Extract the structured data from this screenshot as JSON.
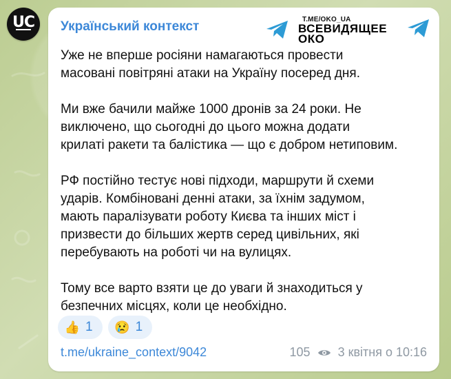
{
  "avatar": {
    "text": "UC"
  },
  "header": {
    "channel_name": "Український контекст"
  },
  "watermark": {
    "small_text": "T.ME/OKO_UA",
    "main_text": "ВСЕВИДЯЩЕЕ\nОКО"
  },
  "message": {
    "paragraphs": [
      "Уже не вперше росіяни намагаються провести\nмасовані повітряні атаки на Україну посеред дня.",
      "Ми вже бачили майже 1000 дронів за 24 роки. Не\nвиключено, що сьогодні до цього можна додати\nкрилаті ракети та балістика — що є добром нетиповим.",
      "РФ постійно тестує нові підходи, маршрути й схеми\nударів. Комбіновані денні атаки, за їхнім задумом,\nмають паралізувати роботу Києва та інших міст і\nпризвести до більших жертв серед цивільних, які\nперебувають на роботі чи на вулицях.",
      "Тому все варто взяти це до уваги й знаходиться у\nбезпечних місцях, коли це необхідно."
    ]
  },
  "reactions": [
    {
      "emoji": "👍",
      "count": "1"
    },
    {
      "emoji": "😢",
      "count": "1"
    }
  ],
  "footer": {
    "link": "t.me/ukraine_context/9042",
    "views": "105",
    "timestamp": "3 квітня о 10:16"
  },
  "colors": {
    "accent": "#3d88d8",
    "bubble": "#ffffff",
    "background": "#c9d7a6",
    "meta": "#8f99a3"
  },
  "icons": {
    "telegram": "telegram-icon",
    "views": "eye-icon"
  }
}
